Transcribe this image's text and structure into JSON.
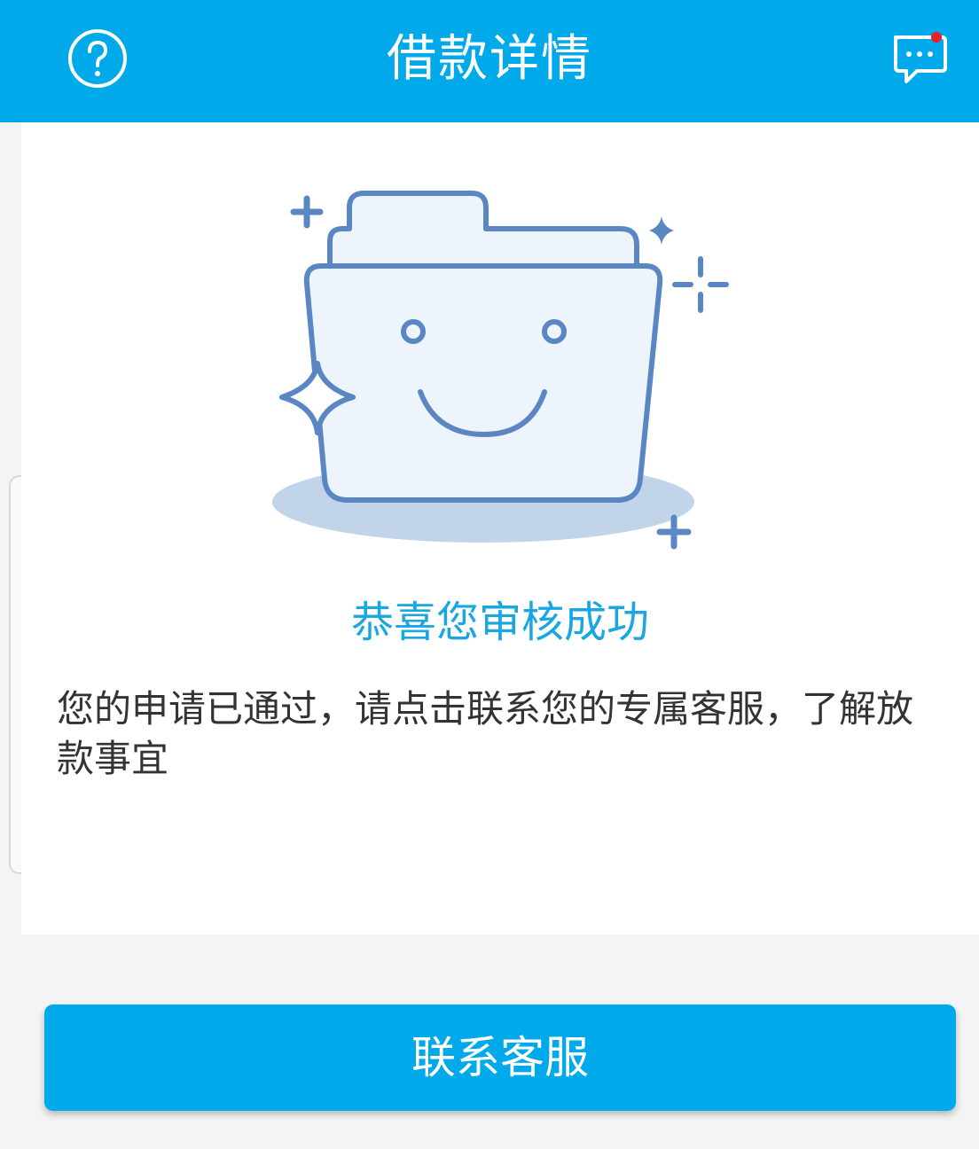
{
  "header": {
    "title": "借款详情",
    "left_icon": "help-circle-icon",
    "right_icon": "chat-message-icon",
    "notification_dot_color": "#e8202a"
  },
  "main": {
    "illustration_icon": "smiling-folder-icon",
    "success_title": "恭喜您审核成功",
    "description": "您的申请已通过，请点击联系您的专属客服，了解放款事宜"
  },
  "footer": {
    "contact_button_label": "联系客服"
  },
  "colors": {
    "primary": "#00a9ea",
    "title_accent": "#1aa6e0",
    "illustration_stroke": "#5b86c4",
    "illustration_fill": "#eef4fb",
    "background": "#f4f4f4"
  }
}
